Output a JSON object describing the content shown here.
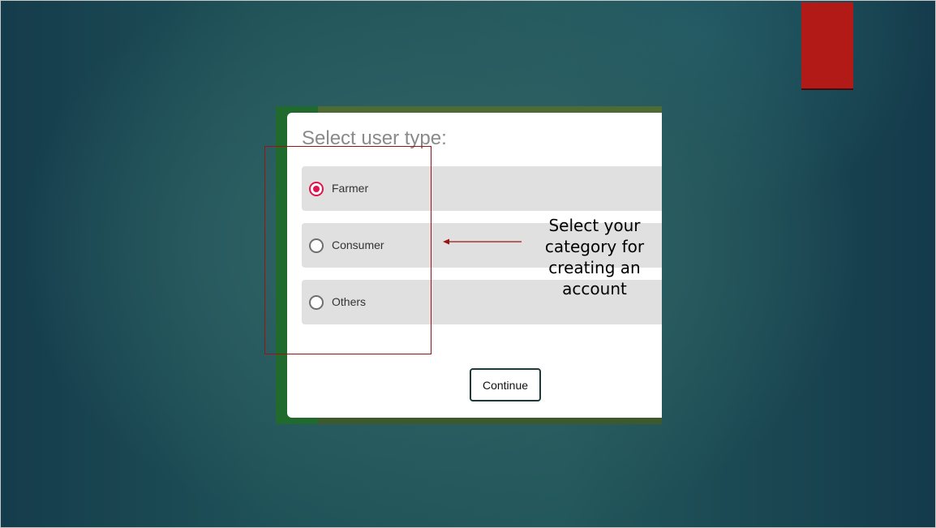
{
  "dialog": {
    "title": "Select user type:",
    "options": [
      {
        "label": "Farmer",
        "selected": true
      },
      {
        "label": "Consumer",
        "selected": false
      },
      {
        "label": "Others",
        "selected": false
      }
    ],
    "continue_label": "Continue"
  },
  "annotation": {
    "text": "Select your category for creating an account"
  },
  "colors": {
    "selected_radio": "#e0144f",
    "annotation_line": "#9b1414",
    "red_tab": "#b11a16"
  }
}
